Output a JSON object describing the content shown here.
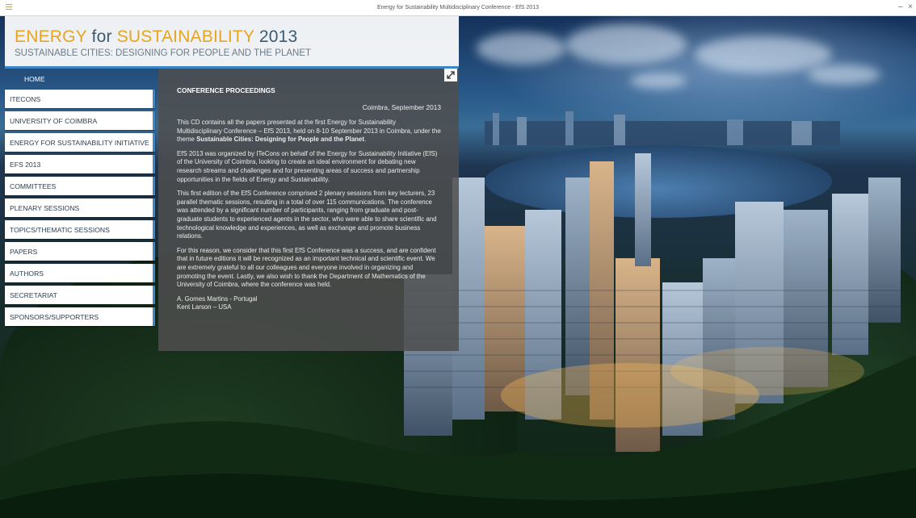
{
  "window": {
    "title": "Energy for Sustainability Multidisciplinary Conference - EfS 2013",
    "minimize": "–",
    "close": "×"
  },
  "header": {
    "brand_w1": "ENERGY",
    "brand_w2": " for ",
    "brand_w3": "SUSTAINABILITY",
    "brand_w4": " 2013",
    "subtitle": "SUSTAINABLE CITIES: DESIGNING FOR PEOPLE AND THE PLANET"
  },
  "nav": {
    "home": "HOME",
    "items": [
      {
        "label": "ITECONS"
      },
      {
        "label": "UNIVERSITY OF COIMBRA"
      },
      {
        "label": "ENERGY FOR SUSTAINABILITY INITIATIVE"
      },
      {
        "label": "EFS 2013"
      },
      {
        "label": "COMMITTEES"
      },
      {
        "label": "PLENARY SESSIONS"
      },
      {
        "label": "TOPICS/THEMATIC SESSIONS"
      },
      {
        "label": "PAPERS"
      },
      {
        "label": "AUTHORS"
      },
      {
        "label": "SECRETARIAT"
      },
      {
        "label": "SPONSORS/SUPPORTERS"
      }
    ]
  },
  "content": {
    "title": "CONFERENCE PROCEEDINGS",
    "date": "Coimbra, September 2013",
    "p1_start": "This CD contains all the papers presented at the first Energy for Sustainability Multidisciplinary Conference – EfS 2013, held on 8-10 September 2013 in Coimbra, under the theme ",
    "p1_bold": "Sustainable Cities: Designing for People and the Planet",
    "p1_end": ".",
    "p2": "EfS 2013 was organized by ITeCons on behalf of the Energy for Sustainability Initiative (EfS) of the University of Coimbra, looking to create an ideal environment for debating new research streams and challenges and for presenting areas of success and partnership opportunities in the fields of Energy and Sustainability.",
    "p3": "This first edition of the EfS Conference comprised 2 plenary sessions from key lecturers, 23 parallel thematic sessions, resulting in a total of over 115 communications. The conference was attended by a significant number of participants, ranging from graduate and post-graduate students to experienced agents in the sector, who were able to share scientific and technological knowledge and experiences, as well as exchange and promote business relations.",
    "p4": "For this reason, we consider that this first EfS Conference was a success, and are confident that in future editions it will be recognized as an important technical and scientific event. We are extremely grateful to all our colleagues and everyone involved in organizing and promoting the event. Lastly, we also wish to thank the Department of Mathematics of the University of Coimbra, where the conference was held.",
    "sig1": "A. Gomes Martins - Portugal",
    "sig2": "Kent Larson – USA"
  },
  "icons": {
    "expand": "expand-icon",
    "app": "app-icon"
  },
  "colors": {
    "accent_blue": "#3c86c6",
    "brand_orange": "#e5a520",
    "brand_slate": "#3c5a72"
  }
}
